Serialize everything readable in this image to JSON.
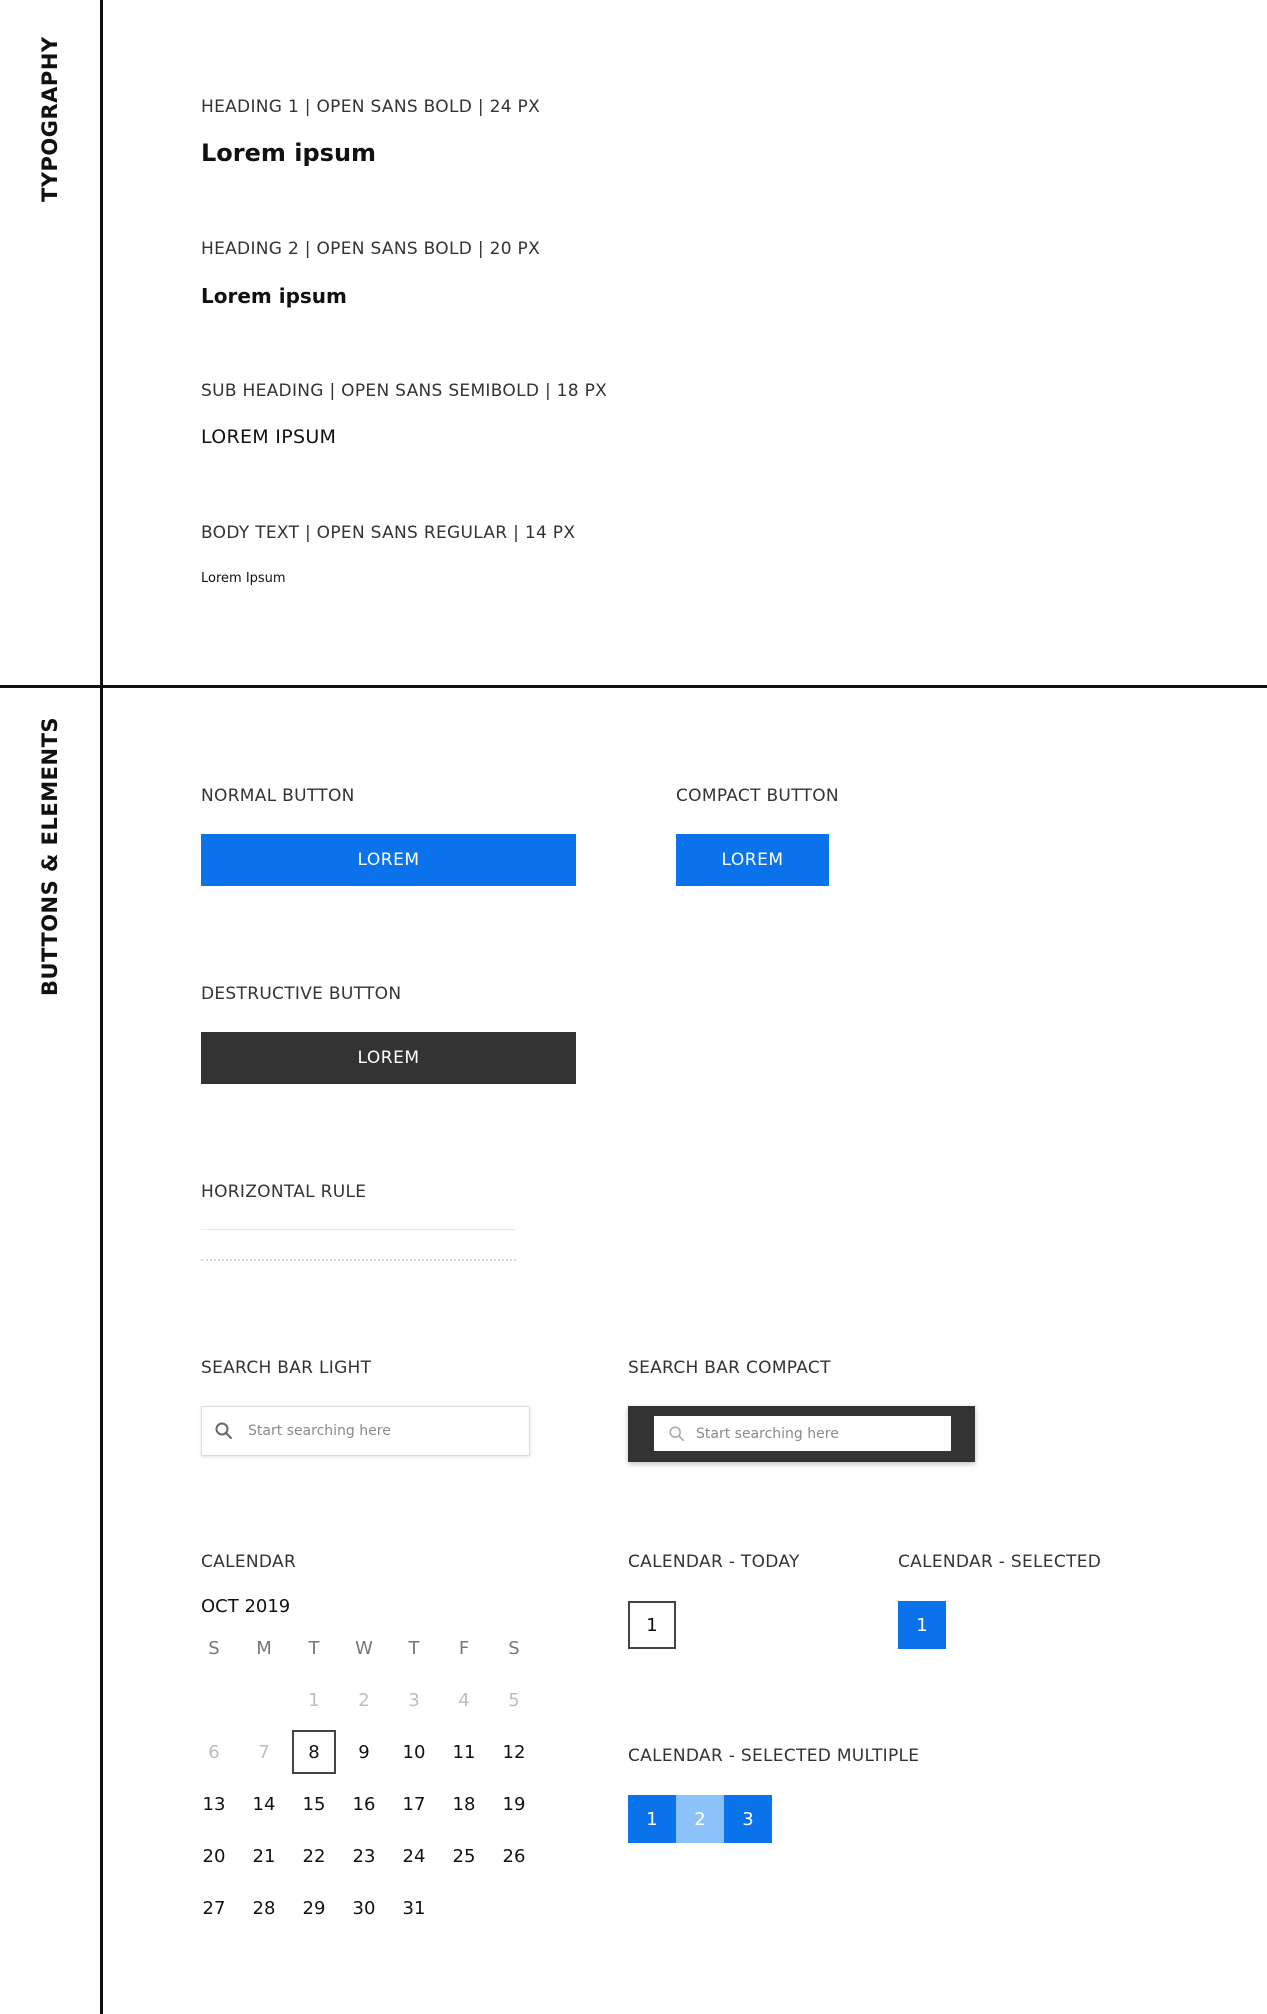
{
  "sections": {
    "typography": "TYPOGRAPHY",
    "buttons": "BUTTONS & ELEMENTS"
  },
  "typography": {
    "h1_label": "HEADING 1 | OPEN SANS BOLD | 24 PX",
    "h1_sample": "Lorem ipsum",
    "h2_label": "HEADING 2 | OPEN SANS BOLD | 20 PX",
    "h2_sample": "Lorem ipsum",
    "sub_label": "SUB HEADING | OPEN SANS SEMIBOLD | 18 PX",
    "sub_sample": "LOREM IPSUM",
    "body_label": "BODY TEXT | OPEN SANS REGULAR | 14 PX",
    "body_sample": "Lorem Ipsum"
  },
  "buttons": {
    "normal_label": "NORMAL BUTTON",
    "normal_text": "LOREM",
    "compact_label": "COMPACT BUTTON",
    "compact_text": "LOREM",
    "destructive_label": "DESTRUCTIVE BUTTON",
    "destructive_text": "LOREM"
  },
  "rule": {
    "label": "HORIZONTAL RULE"
  },
  "search": {
    "light_label": "SEARCH BAR LIGHT",
    "light_placeholder": "Start searching here",
    "compact_label": "SEARCH BAR COMPACT",
    "compact_placeholder": "Start searching here"
  },
  "calendar": {
    "label": "CALENDAR",
    "month": "OCT 2019",
    "weekdays": [
      "S",
      "M",
      "T",
      "W",
      "T",
      "F",
      "S"
    ],
    "leading_blanks": 2,
    "days_shown": [
      "1",
      "2",
      "3",
      "4",
      "5",
      "6",
      "7",
      "8",
      "9",
      "10",
      "11",
      "12",
      "13",
      "14",
      "15",
      "16",
      "17",
      "18",
      "19",
      "20",
      "21",
      "22",
      "23",
      "24",
      "25",
      "26",
      "27",
      "28",
      "29",
      "30",
      "31"
    ],
    "muted_days": [
      "1",
      "2",
      "3",
      "4",
      "5",
      "6",
      "7"
    ],
    "today": "8",
    "today_label": "CALENDAR - TODAY",
    "today_sample": "1",
    "selected_label": "CALENDAR - SELECTED",
    "selected_sample": "1",
    "multiple_label": "CALENDAR - SELECTED MULTIPLE",
    "multiple_days": [
      "1",
      "2",
      "3"
    ]
  },
  "colors": {
    "primary": "#0a73eb",
    "primary_light": "#8cc4fa",
    "dark": "#333333",
    "muted": "#bdbdbd"
  }
}
